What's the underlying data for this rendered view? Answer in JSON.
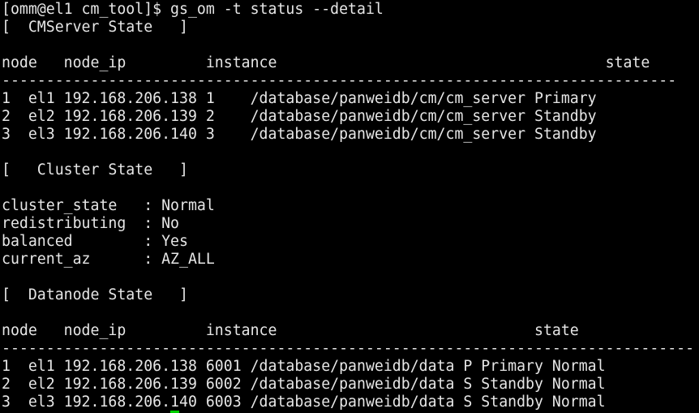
{
  "terminal": {
    "cursor_color": "#00d000",
    "text_color": "#e6e6e6",
    "background_color": "#000000",
    "lines": [
      "[omm@el1 cm_tool]$ gs_om -t status --detail",
      "[  CMServer State   ]",
      "",
      "node   node_ip         instance                                     state",
      "----------------------------------------------------------------------------",
      "1  el1 192.168.206.138 1    /database/panweidb/cm/cm_server Primary",
      "2  el2 192.168.206.139 2    /database/panweidb/cm/cm_server Standby",
      "3  el3 192.168.206.140 3    /database/panweidb/cm/cm_server Standby",
      "",
      "[   Cluster State   ]",
      "",
      "cluster_state   : Normal",
      "redistributing  : No",
      "balanced        : Yes",
      "current_az      : AZ_ALL",
      "",
      "[  Datanode State   ]",
      "",
      "node   node_ip         instance                             state",
      "------------------------------------------------------------------------------",
      "1  el1 192.168.206.138 6001 /database/panweidb/data P Primary Normal",
      "2  el2 192.168.206.139 6002 /database/panweidb/data S Standby Normal",
      "3  el3 192.168.206.140 6003 /database/panweidb/data S Standby Normal"
    ]
  }
}
